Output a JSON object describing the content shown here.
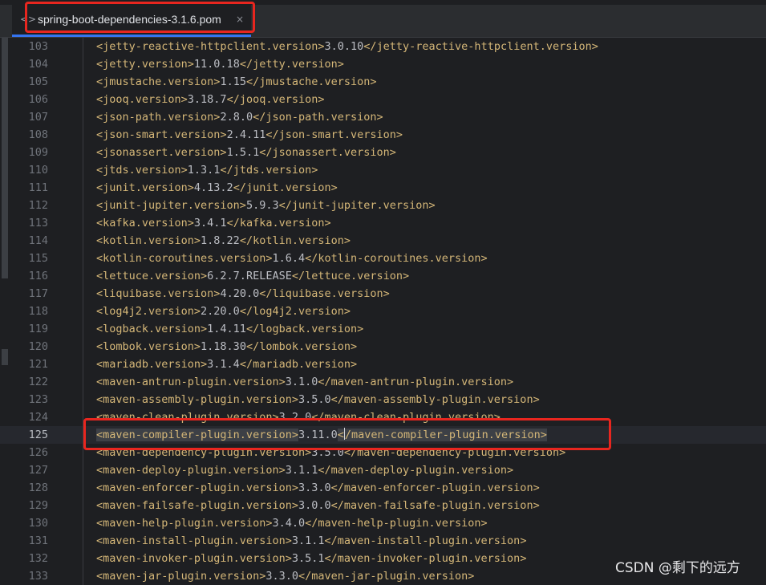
{
  "tab": {
    "icon": "xml-file-icon",
    "icon_glyph": "<>",
    "title": "spring-boot-dependencies-3.1.6.pom",
    "close_glyph": "×"
  },
  "editor": {
    "current_line": 125,
    "lines": [
      {
        "n": "103",
        "tag": "jetty-reactive-httpclient.version",
        "value": "3.0.10"
      },
      {
        "n": "104",
        "tag": "jetty.version",
        "value": "11.0.18"
      },
      {
        "n": "105",
        "tag": "jmustache.version",
        "value": "1.15"
      },
      {
        "n": "106",
        "tag": "jooq.version",
        "value": "3.18.7"
      },
      {
        "n": "107",
        "tag": "json-path.version",
        "value": "2.8.0"
      },
      {
        "n": "108",
        "tag": "json-smart.version",
        "value": "2.4.11"
      },
      {
        "n": "109",
        "tag": "jsonassert.version",
        "value": "1.5.1"
      },
      {
        "n": "110",
        "tag": "jtds.version",
        "value": "1.3.1"
      },
      {
        "n": "111",
        "tag": "junit.version",
        "value": "4.13.2"
      },
      {
        "n": "112",
        "tag": "junit-jupiter.version",
        "value": "5.9.3"
      },
      {
        "n": "113",
        "tag": "kafka.version",
        "value": "3.4.1"
      },
      {
        "n": "114",
        "tag": "kotlin.version",
        "value": "1.8.22"
      },
      {
        "n": "115",
        "tag": "kotlin-coroutines.version",
        "value": "1.6.4"
      },
      {
        "n": "116",
        "tag": "lettuce.version",
        "value": "6.2.7.RELEASE"
      },
      {
        "n": "117",
        "tag": "liquibase.version",
        "value": "4.20.0"
      },
      {
        "n": "118",
        "tag": "log4j2.version",
        "value": "2.20.0"
      },
      {
        "n": "119",
        "tag": "logback.version",
        "value": "1.4.11"
      },
      {
        "n": "120",
        "tag": "lombok.version",
        "value": "1.18.30"
      },
      {
        "n": "121",
        "tag": "mariadb.version",
        "value": "3.1.4"
      },
      {
        "n": "122",
        "tag": "maven-antrun-plugin.version",
        "value": "3.1.0"
      },
      {
        "n": "123",
        "tag": "maven-assembly-plugin.version",
        "value": "3.5.0"
      },
      {
        "n": "124",
        "tag": "maven-clean-plugin.version",
        "value": "3.2.0"
      },
      {
        "n": "125",
        "tag": "maven-compiler-plugin.version",
        "value": "3.11.0"
      },
      {
        "n": "126",
        "tag": "maven-dependency-plugin.version",
        "value": "3.5.0"
      },
      {
        "n": "127",
        "tag": "maven-deploy-plugin.version",
        "value": "3.1.1"
      },
      {
        "n": "128",
        "tag": "maven-enforcer-plugin.version",
        "value": "3.3.0"
      },
      {
        "n": "129",
        "tag": "maven-failsafe-plugin.version",
        "value": "3.0.0"
      },
      {
        "n": "130",
        "tag": "maven-help-plugin.version",
        "value": "3.4.0"
      },
      {
        "n": "131",
        "tag": "maven-install-plugin.version",
        "value": "3.1.1"
      },
      {
        "n": "132",
        "tag": "maven-invoker-plugin.version",
        "value": "3.5.1"
      },
      {
        "n": "133",
        "tag": "maven-jar-plugin.version",
        "value": "3.3.0"
      }
    ]
  },
  "watermark": "CSDN @剩下的远方",
  "colors": {
    "background": "#1e1f22",
    "tag": "#d5b778",
    "text": "#bcbec4",
    "annotation": "#e8261f",
    "tab_accent": "#3574f0"
  }
}
